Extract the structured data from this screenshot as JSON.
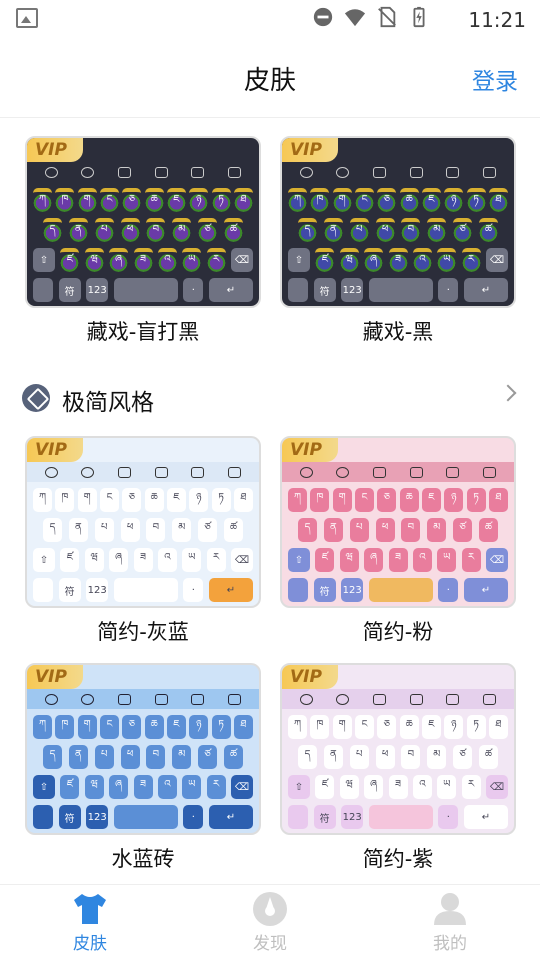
{
  "status_bar": {
    "time": "11:21"
  },
  "header": {
    "title": "皮肤",
    "login_label": "登录"
  },
  "section": {
    "title": "极简风格"
  },
  "skins_top": [
    {
      "label": "藏戏-盲打黑",
      "badge": "VIP",
      "theme": "dark-mask"
    },
    {
      "label": "藏戏-黑",
      "badge": "VIP",
      "theme": "dark-blue"
    }
  ],
  "skins_grid": [
    {
      "label": "简约-灰蓝",
      "badge": "VIP",
      "theme": "lightblue"
    },
    {
      "label": "简约-粉",
      "badge": "VIP",
      "theme": "pink"
    },
    {
      "label": "水蓝砖",
      "badge": "VIP",
      "theme": "waterblue"
    },
    {
      "label": "简约-紫",
      "badge": "VIP",
      "theme": "purple"
    }
  ],
  "keyboard": {
    "num_key": "123",
    "symbol_key": "符",
    "row1": [
      "ཀ",
      "ཁ",
      "ག",
      "ང",
      "ཅ",
      "ཆ",
      "ཇ",
      "ཉ",
      "ཏ",
      "ཐ"
    ],
    "row2": [
      "ད",
      "ན",
      "པ",
      "ཕ",
      "བ",
      "མ",
      "ཙ",
      "ཚ"
    ],
    "row3": [
      "ཛ",
      "ཝ",
      "ཞ",
      "ཟ",
      "འ",
      "ཡ",
      "ར"
    ]
  },
  "bottom_nav": [
    {
      "label": "皮肤",
      "active": true
    },
    {
      "label": "发现",
      "active": false
    },
    {
      "label": "我的",
      "active": false
    }
  ],
  "colors": {
    "accent": "#2f86e0",
    "inactive": "#bfbfbf"
  }
}
